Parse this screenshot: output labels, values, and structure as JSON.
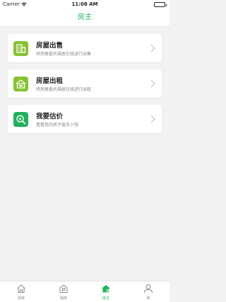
{
  "status_bar": {
    "carrier": "Carrier",
    "time": "11:08 AM",
    "wifi_icon": "wifi-icon",
    "battery_icon": "battery-icon"
  },
  "nav": {
    "title": "房主"
  },
  "cards": [
    {
      "title": "房屋出售",
      "subtitle": "将房屋委托福居在线进行出售",
      "icon": "building-sale-icon",
      "icon_color": "#86c12f"
    },
    {
      "title": "房屋出租",
      "subtitle": "将房屋委托福居在线进行出租",
      "icon": "house-rent-icon",
      "icon_color": "#86c12f"
    },
    {
      "title": "我要估价",
      "subtitle": "看看我的房子值多少钱",
      "icon": "valuation-search-icon",
      "icon_color": "#1fb25a"
    }
  ],
  "tabs": [
    {
      "label": "买房",
      "icon": "house-icon",
      "active": false
    },
    {
      "label": "租房",
      "icon": "rent-house-icon",
      "active": false
    },
    {
      "label": "房主",
      "icon": "owner-house-icon",
      "active": true
    },
    {
      "label": "我",
      "icon": "person-icon",
      "active": false
    }
  ],
  "colors": {
    "accent": "#1fb25a",
    "card_icon_green": "#86c12f",
    "background": "#f2f2f2"
  }
}
